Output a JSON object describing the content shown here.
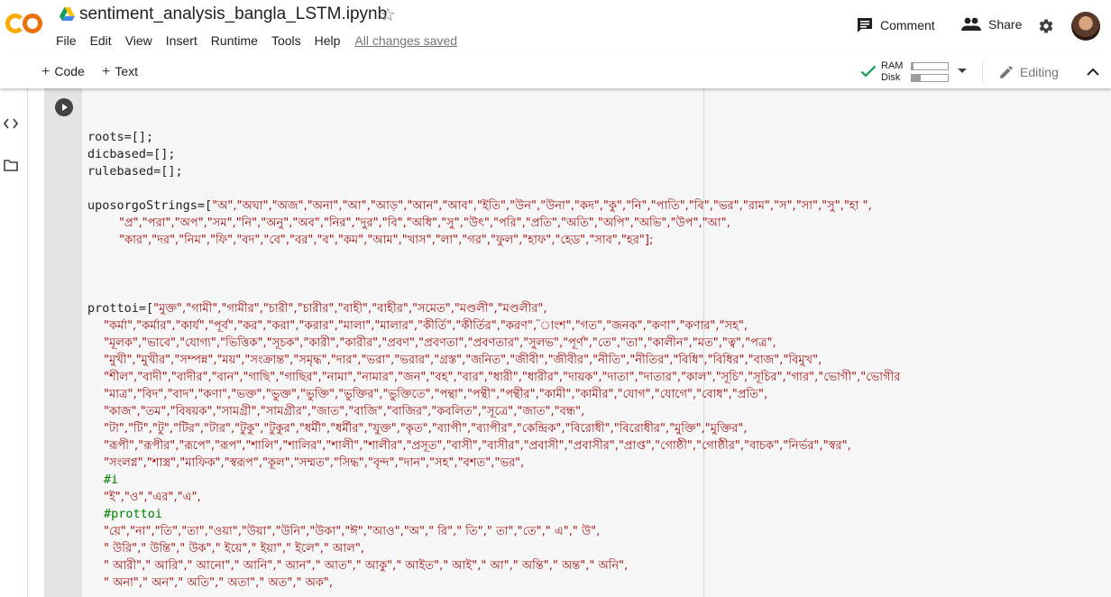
{
  "app": {
    "logo_text": "CO",
    "notebook_title": "sentiment_analysis_bangla_LSTM.ipynb",
    "star_icon": "star-outline-icon",
    "drive_icon": "google-drive-icon"
  },
  "menu": {
    "items": [
      "File",
      "Edit",
      "View",
      "Insert",
      "Runtime",
      "Tools",
      "Help"
    ],
    "save_status": "All changes saved"
  },
  "header_actions": {
    "comment_label": "Comment",
    "share_label": "Share",
    "settings_icon": "gear-icon"
  },
  "toolbar": {
    "add_code_label": "Code",
    "add_text_label": "Text",
    "ram_label": "RAM",
    "disk_label": "Disk",
    "ram_usage": 0.05,
    "disk_usage": 0.25,
    "editing_label": "Editing"
  },
  "colors": {
    "logo_orange": "#F9AB00",
    "logo_dark_orange": "#E8710A",
    "string_red": "#a31515",
    "comment_green": "#008000",
    "check_green": "#0F9D58"
  },
  "code": {
    "lines": [
      {
        "text": "",
        "kind": "plain"
      },
      {
        "text": "roots=[];",
        "kind": "plain"
      },
      {
        "text": "dicbased=[];",
        "kind": "plain"
      },
      {
        "text": "rulebased=[];",
        "kind": "plain"
      },
      {
        "text": "",
        "kind": "plain"
      },
      {
        "text": "uposorgoStrings=[\"অ\",\"অঘা\",\"অজ\",\"অনা\",\"আ\",\"আড়\",\"আন\",\"আব\",\"ইতি\",\"উন\",\"উনা\",\"কদ\",\"কু\",\"নি\",\"পাতি\",\"বি\",\"ভর\",\"রাম\",\"স\",\"সা\",\"সু\",\"হা \",",
        "kind": "mixed"
      },
      {
        "text": "\"প্র\",\"পরা\",\"অপ\",\"সম\",\"নি\",\"অনু\",\"অব\",\"নির\",\"দুর\",\"বি\",\"অধি\",\"সু\",\"উৎ\",\"পরি\",\"প্রতি\",\"অতি\",\"অপি\",\"অভি\",\"উপ\",\"আ\",",
        "kind": "bn",
        "indent": 1
      },
      {
        "text": "\"কার\",\"দর\",\"নিম\",\"ফি\",\"বদ\",\"বে\",\"বর\",\"ব\",\"কম\",\"আম\",\"খাস\",\"লা\",\"গর\",\"ফুল\",\"হাফ\",\"হেড\",\"সাব\",\"হর\"];",
        "kind": "bn",
        "indent": 1
      },
      {
        "text": "",
        "kind": "plain"
      },
      {
        "text": "",
        "kind": "plain"
      },
      {
        "text": "",
        "kind": "plain"
      },
      {
        "text": "prottoi=[\"মুক্ত\",\"গামী\",\"গামীর\",\"চারী\",\"চারীর\",\"বাহী\",\"বাহীর\",\"সমেত\",\"মণ্ডলী\",\"মণ্ডলীর\",",
        "kind": "mixed"
      },
      {
        "text": "\"কর্মা\",\"কর্মার\",\"কার্য\",\"পূর্ব\",\"কর\",\"করা\",\"করার\",\"মালা\",\"মালার\",\"কীর্তি\",\"কীর্তির\",\"করণ\",\"াংশ\",\"গত\",\"জনক\",\"কণা\",\"কণার\",\"সহ\",",
        "kind": "bn",
        "indent": 2
      },
      {
        "text": "\"মূলক\",\"ভাবে\",\"যোগ্য\",\"ভিত্তিক\",\"সূচক\",\"কারী\",\"কারীর\",\"প্রবণ\",\"প্রবণতা\",\"প্রবণতার\",\"সুলভ\",\"পূর্ণ\",\"তে\",\"তা\",\"কালীন\",\"মত\",\"ত্ব\",\"পত্র\",",
        "kind": "bn",
        "indent": 2
      },
      {
        "text": "\"মুখী\",\"মুখীর\",\"সম্পন্ন\",\"ময়\",\"সংক্রান্ত\",\"সমৃদ্ধ\",\"দার\",\"ভরা\",\"ভরার\",\"গ্রস্ত\",\"জনিত\",\"জীবী\",\"জীবীর\",\"নীতি\",\"নীতির\",\"বিধি\",\"বিধির\",\"বাজ\",\"বিমুখ\",",
        "kind": "bn",
        "indent": 2
      },
      {
        "text": "\"শীল\",\"বাদী\",\"বাদীর\",\"বান\",\"গাছি\",\"গাছির\",\"নামা\",\"নামার\",\"জন\",\"বহ\",\"বার\",\"ধারী\",\"ধারীর\",\"দায়ক\",\"দাতা\",\"দাতার\",\"কাল\",\"সূচি\",\"সূচির\",\"গার\",\"ভোগী\",\"ভোগীর",
        "kind": "bn",
        "indent": 2
      },
      {
        "text": "\"মাত্র\",\"বিদ\",\"বাদ\",\"কণা\",\"ভক্ত\",\"ভুক্ত\",\"ভুক্তি\",\"ভুক্তির\",\"ভুক্তিতে\",\"পন্থা\",\"পন্থী\",\"পন্থীর\",\"কামী\",\"কামীর\",\"যোগ\",\"যোগে\",\"বোধ\",\"প্রতি\",",
        "kind": "bn",
        "indent": 2
      },
      {
        "text": "\"কাজ\",\"তম\",\"বিষয়ক\",\"সামগ্রী\",\"সামগ্রীর\",\"জাত\",\"বাজি\",\"বাজির\",\"কবলিত\",\"সূত্রে\",\"জাত\",\"বন্ধ\",",
        "kind": "bn",
        "indent": 2
      },
      {
        "text": "\"টা\",\"টি\",\"টু\",\"টির\",\"টার\",\"টুকু\",\"টুকুর\",\"ধর্মী\",\"ধর্মীর\",\"যুক্ত\",\"কৃত\",\"ব্যাপী\",\"ব্যাপীর\",\"কেন্দ্রিক\",\"বিরোধী\",\"বিরোধীর\",\"মুক্তি\",\"মুক্তির\",",
        "kind": "bn",
        "indent": 2
      },
      {
        "text": "\"রূপী\",\"রূপীর\",\"রূপে\",\"রূপ\",\"শালি\",\"শালির\",\"শালী\",\"শালীর\",\"প্রসূত\",\"বাসী\",\"বাসীর\",\"প্রবাসী\",\"প্রবাসীর\",\"প্রাপ্ত\",\"গোষ্ঠী\",\"গোষ্ঠীর\",\"বাচক\",\"নির্ভর\",\"স্বর\",",
        "kind": "bn",
        "indent": 2
      },
      {
        "text": "\"সংলগ্ন\",\"শাস্ত্র\",\"মাফিক\",\"স্বরূপ\",\"কূল\",\"সম্মত\",\"সিদ্ধ\",\"বৃন্দ\",\"দান\",\"সহ\",\"বশত\",\"ভর\",",
        "kind": "bn",
        "indent": 2
      },
      {
        "text": "#i",
        "kind": "cm",
        "indent": 2
      },
      {
        "text": "\"ই\",\"ও\",\"এর\",\"এ\",",
        "kind": "bn",
        "indent": 2
      },
      {
        "text": "#prottoi",
        "kind": "cm",
        "indent": 2
      },
      {
        "text": "\"য়ে\",\"না\",\"তি\",\"তা\",\"ওয়া\",\"উয়া\",\"উনি\",\"উকা\",\"ঈ\",\"আও\",\"অ\",\" রি\",\" তি\",\" তা\",\"তে\",\" এ\",\" উ\",",
        "kind": "bn",
        "indent": 2
      },
      {
        "text": "\" উরি\",\" উন্তি\",\" উক\",\" ইয়ে\",\" ইয়া\",\" ইলে\",\" আল\",",
        "kind": "bn",
        "indent": 2
      },
      {
        "text": "\" আরী\",\" আরি\",\" আনো\",\" আনি\",\" আন\",\" আত\",\" আকু\",\" আইত\",\" আই\",\" আ\",\" অন্তি\",\" অন্ত\",\" অনি\",",
        "kind": "bn",
        "indent": 2
      },
      {
        "text": "\" অনা\",\" অন\",\" অতি\",\" অতা\",\" অত\",\" অক\",",
        "kind": "bn",
        "indent": 2
      }
    ]
  }
}
